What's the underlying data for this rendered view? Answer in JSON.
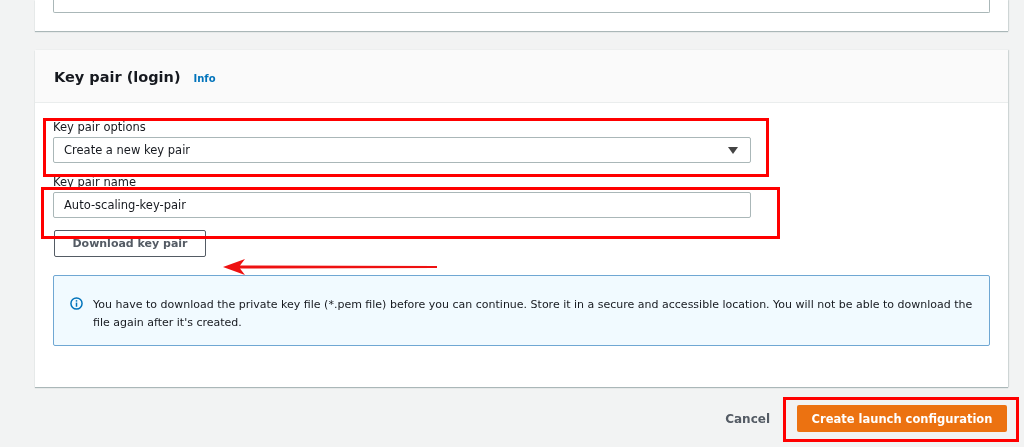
{
  "panel": {
    "title": "Key pair (login)",
    "info_link": "Info"
  },
  "fields": [
    {
      "kind": "select",
      "label": "Key pair options",
      "value": "Create a new key pair"
    },
    {
      "kind": "text",
      "label": "Key pair name",
      "value": "Auto-scaling-key-pair"
    }
  ],
  "download_button": "Download key pair",
  "alert": {
    "kind": "info",
    "text": "You have to download the private key file (*.pem file) before you can continue. Store it in a secure and accessible location. You will not be able to download the file again after it's created."
  },
  "footer": {
    "cancel": "Cancel",
    "primary": "Create launch configuration"
  }
}
